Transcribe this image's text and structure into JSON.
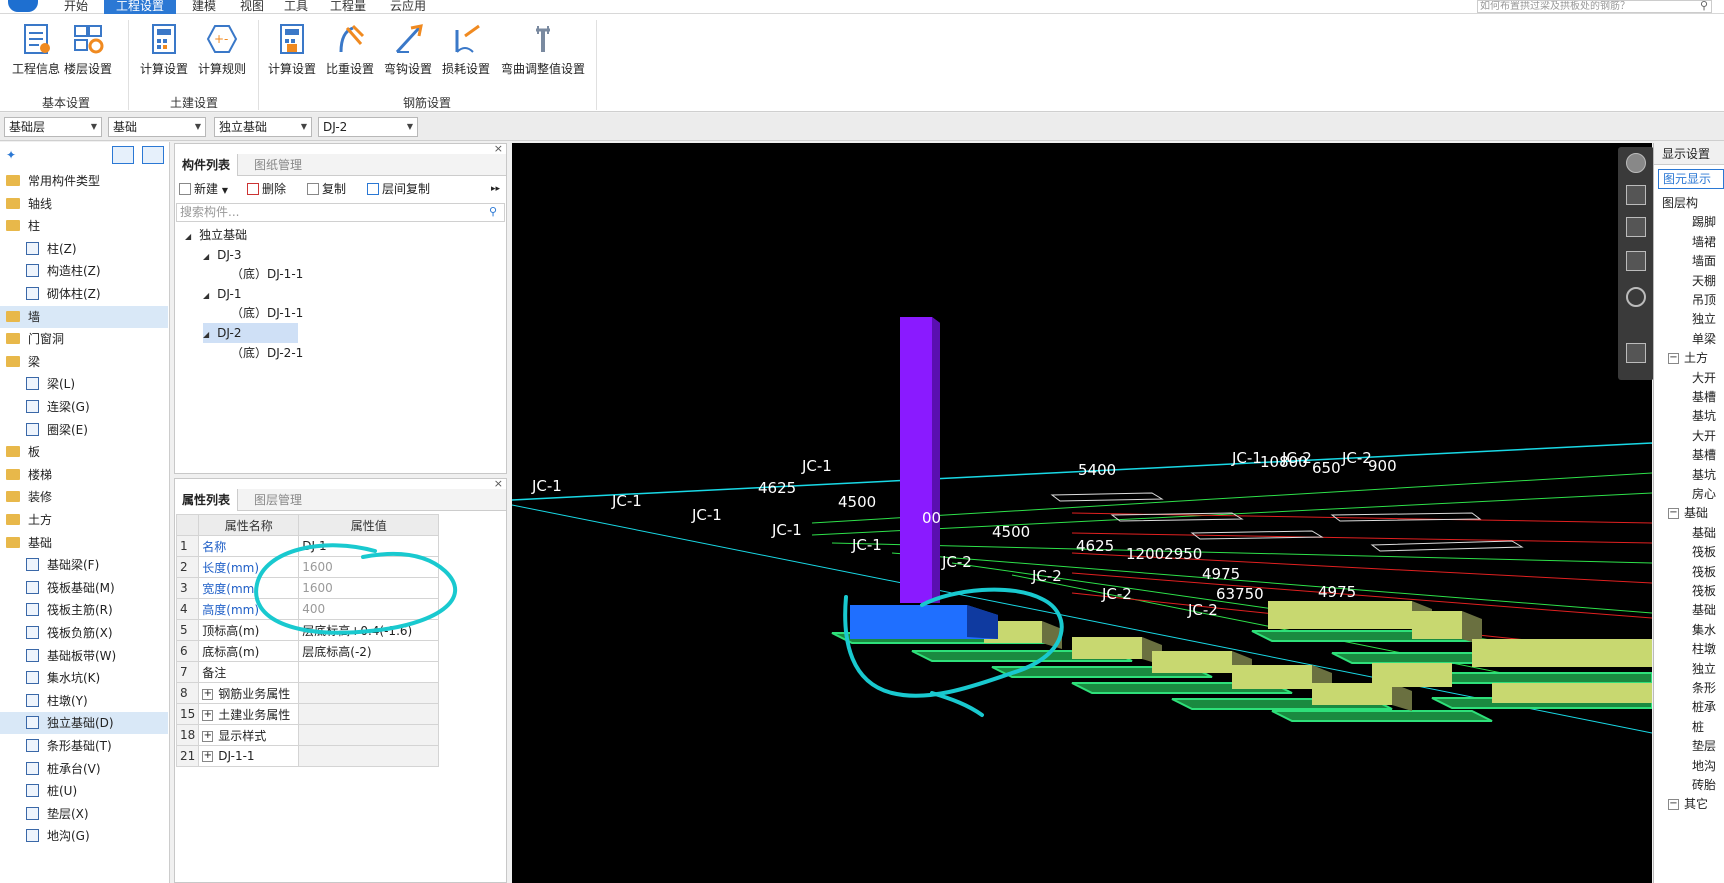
{
  "menu": {
    "items": [
      "开始",
      "工程设置",
      "建模",
      "视图",
      "工具",
      "工程量",
      "云应用"
    ],
    "active_index": 1,
    "help_placeholder": "如何布置拱过梁及拱板处的钢筋？"
  },
  "ribbon": {
    "groups": [
      {
        "label": "基本设置",
        "buttons": [
          "工程信息",
          "楼层设置"
        ]
      },
      {
        "label": "土建设置",
        "buttons": [
          "计算设置",
          "计算规则"
        ]
      },
      {
        "label": "钢筋设置",
        "buttons": [
          "计算设置",
          "比重设置",
          "弯钩设置",
          "损耗设置",
          "弯曲调整值设置"
        ]
      }
    ]
  },
  "selectors": {
    "floor": "基础层",
    "category": "基础",
    "type": "独立基础",
    "component": "DJ-2"
  },
  "left_tree": {
    "items": [
      {
        "label": "常用构件类型",
        "kind": "folder"
      },
      {
        "label": "轴线",
        "kind": "folder"
      },
      {
        "label": "柱",
        "kind": "folder"
      },
      {
        "label": "柱(Z)",
        "kind": "item"
      },
      {
        "label": "构造柱(Z)",
        "kind": "item"
      },
      {
        "label": "砌体柱(Z)",
        "kind": "item"
      },
      {
        "label": "墙",
        "kind": "folder"
      },
      {
        "label": "门窗洞",
        "kind": "folder"
      },
      {
        "label": "梁",
        "kind": "folder"
      },
      {
        "label": "梁(L)",
        "kind": "item"
      },
      {
        "label": "连梁(G)",
        "kind": "item"
      },
      {
        "label": "圈梁(E)",
        "kind": "item"
      },
      {
        "label": "板",
        "kind": "folder"
      },
      {
        "label": "楼梯",
        "kind": "folder"
      },
      {
        "label": "装修",
        "kind": "folder"
      },
      {
        "label": "土方",
        "kind": "folder"
      },
      {
        "label": "基础",
        "kind": "folder"
      },
      {
        "label": "基础梁(F)",
        "kind": "item"
      },
      {
        "label": "筏板基础(M)",
        "kind": "item"
      },
      {
        "label": "筏板主筋(R)",
        "kind": "item"
      },
      {
        "label": "筏板负筋(X)",
        "kind": "item"
      },
      {
        "label": "基础板带(W)",
        "kind": "item"
      },
      {
        "label": "集水坑(K)",
        "kind": "item"
      },
      {
        "label": "柱墩(Y)",
        "kind": "item"
      },
      {
        "label": "独立基础(D)",
        "kind": "item"
      },
      {
        "label": "条形基础(T)",
        "kind": "item"
      },
      {
        "label": "桩承台(V)",
        "kind": "item"
      },
      {
        "label": "桩(U)",
        "kind": "item"
      },
      {
        "label": "垫层(X)",
        "kind": "item"
      },
      {
        "label": "地沟(G)",
        "kind": "item"
      }
    ]
  },
  "component_panel": {
    "tabs": [
      "构件列表",
      "图纸管理"
    ],
    "toolbar": [
      "新建",
      "删除",
      "复制",
      "层间复制"
    ],
    "search_placeholder": "搜索构件...",
    "tree": [
      {
        "label": "独立基础",
        "level": 0,
        "tri": true
      },
      {
        "label": "DJ-3",
        "level": 1,
        "tri": true
      },
      {
        "label": "（底）DJ-1-1",
        "level": 2,
        "tri": false
      },
      {
        "label": "DJ-1",
        "level": 1,
        "tri": true
      },
      {
        "label": "（底）DJ-1-1",
        "level": 2,
        "tri": false
      },
      {
        "label": "DJ-2",
        "level": 1,
        "tri": true,
        "selected": true
      },
      {
        "label": "（底）DJ-2-1",
        "level": 2,
        "tri": false
      }
    ]
  },
  "property_panel": {
    "tabs": [
      "属性列表",
      "图层管理"
    ],
    "headers": [
      "属性名称",
      "属性值"
    ],
    "rows": [
      {
        "no": "1",
        "name": "名称",
        "value": "DJ-1",
        "name_blue": true,
        "value_grey": false,
        "expand": false
      },
      {
        "no": "2",
        "name": "长度(mm)",
        "value": "1600",
        "name_blue": true,
        "value_grey": true,
        "expand": false
      },
      {
        "no": "3",
        "name": "宽度(mm)",
        "value": "1600",
        "name_blue": true,
        "value_grey": true,
        "expand": false
      },
      {
        "no": "4",
        "name": "高度(mm)",
        "value": "400",
        "name_blue": true,
        "value_grey": true,
        "expand": false
      },
      {
        "no": "5",
        "name": "顶标高(m)",
        "value": "层底标高+0.4(-1.6)",
        "name_blue": false,
        "value_grey": false,
        "expand": false
      },
      {
        "no": "6",
        "name": "底标高(m)",
        "value": "层底标高(-2)",
        "name_blue": false,
        "value_grey": false,
        "expand": false
      },
      {
        "no": "7",
        "name": "备注",
        "value": "",
        "name_blue": false,
        "value_grey": false,
        "expand": false
      },
      {
        "no": "8",
        "name": "钢筋业务属性",
        "value": "",
        "name_blue": false,
        "value_grey": false,
        "expand": true
      },
      {
        "no": "15",
        "name": "土建业务属性",
        "value": "",
        "name_blue": false,
        "value_grey": false,
        "expand": true
      },
      {
        "no": "18",
        "name": "显示样式",
        "value": "",
        "name_blue": false,
        "value_grey": false,
        "expand": true
      },
      {
        "no": "21",
        "name": "DJ-1-1",
        "value": "",
        "name_blue": false,
        "value_grey": false,
        "expand": true
      }
    ]
  },
  "viewport_labels": {
    "jc": [
      "JC-1",
      "JC-1",
      "JC-1",
      "JC-1",
      "JC-1",
      "JC-1",
      "JC-2",
      "JC-2",
      "JC-2",
      "JC-2",
      "JC-1",
      "JC-2",
      "JC-2"
    ],
    "dims": [
      "5400",
      "4625",
      "4500",
      "00",
      "4500",
      "4625",
      "12002950",
      "4975",
      "63750",
      "4975",
      "10800",
      "650",
      "900"
    ]
  },
  "right_panel": {
    "title": "显示设置",
    "tab": "图元显示",
    "rows": [
      {
        "label": "图层构",
        "indent": false,
        "box": false
      },
      {
        "label": "踢脚",
        "indent": true
      },
      {
        "label": "墙裙",
        "indent": true
      },
      {
        "label": "墙面",
        "indent": true
      },
      {
        "label": "天棚",
        "indent": true
      },
      {
        "label": "吊顶",
        "indent": true
      },
      {
        "label": "独立",
        "indent": true
      },
      {
        "label": "单梁",
        "indent": true
      },
      {
        "label": "土方",
        "indent": false,
        "box": true
      },
      {
        "label": "大开",
        "indent": true
      },
      {
        "label": "基槽",
        "indent": true
      },
      {
        "label": "基坑",
        "indent": true
      },
      {
        "label": "大开",
        "indent": true
      },
      {
        "label": "基槽",
        "indent": true
      },
      {
        "label": "基坑",
        "indent": true
      },
      {
        "label": "房心",
        "indent": true
      },
      {
        "label": "基础",
        "indent": false,
        "box": true
      },
      {
        "label": "基础",
        "indent": true
      },
      {
        "label": "筏板",
        "indent": true
      },
      {
        "label": "筏板",
        "indent": true
      },
      {
        "label": "筏板",
        "indent": true
      },
      {
        "label": "基础",
        "indent": true
      },
      {
        "label": "集水",
        "indent": true
      },
      {
        "label": "柱墩",
        "indent": true
      },
      {
        "label": "独立",
        "indent": true
      },
      {
        "label": "条形",
        "indent": true
      },
      {
        "label": "桩承",
        "indent": true
      },
      {
        "label": "桩",
        "indent": true
      },
      {
        "label": "垫层",
        "indent": true
      },
      {
        "label": "地沟",
        "indent": true
      },
      {
        "label": "砖胎",
        "indent": true
      },
      {
        "label": "其它",
        "indent": false,
        "box": true
      }
    ]
  },
  "colors": {
    "accent": "#2b78d4",
    "column": "#8a1aff",
    "selected_foundation": "#1f6fff",
    "foundation_top": "#c8d870",
    "pad": "#2ee07a",
    "annotation": "#19c9cf"
  }
}
